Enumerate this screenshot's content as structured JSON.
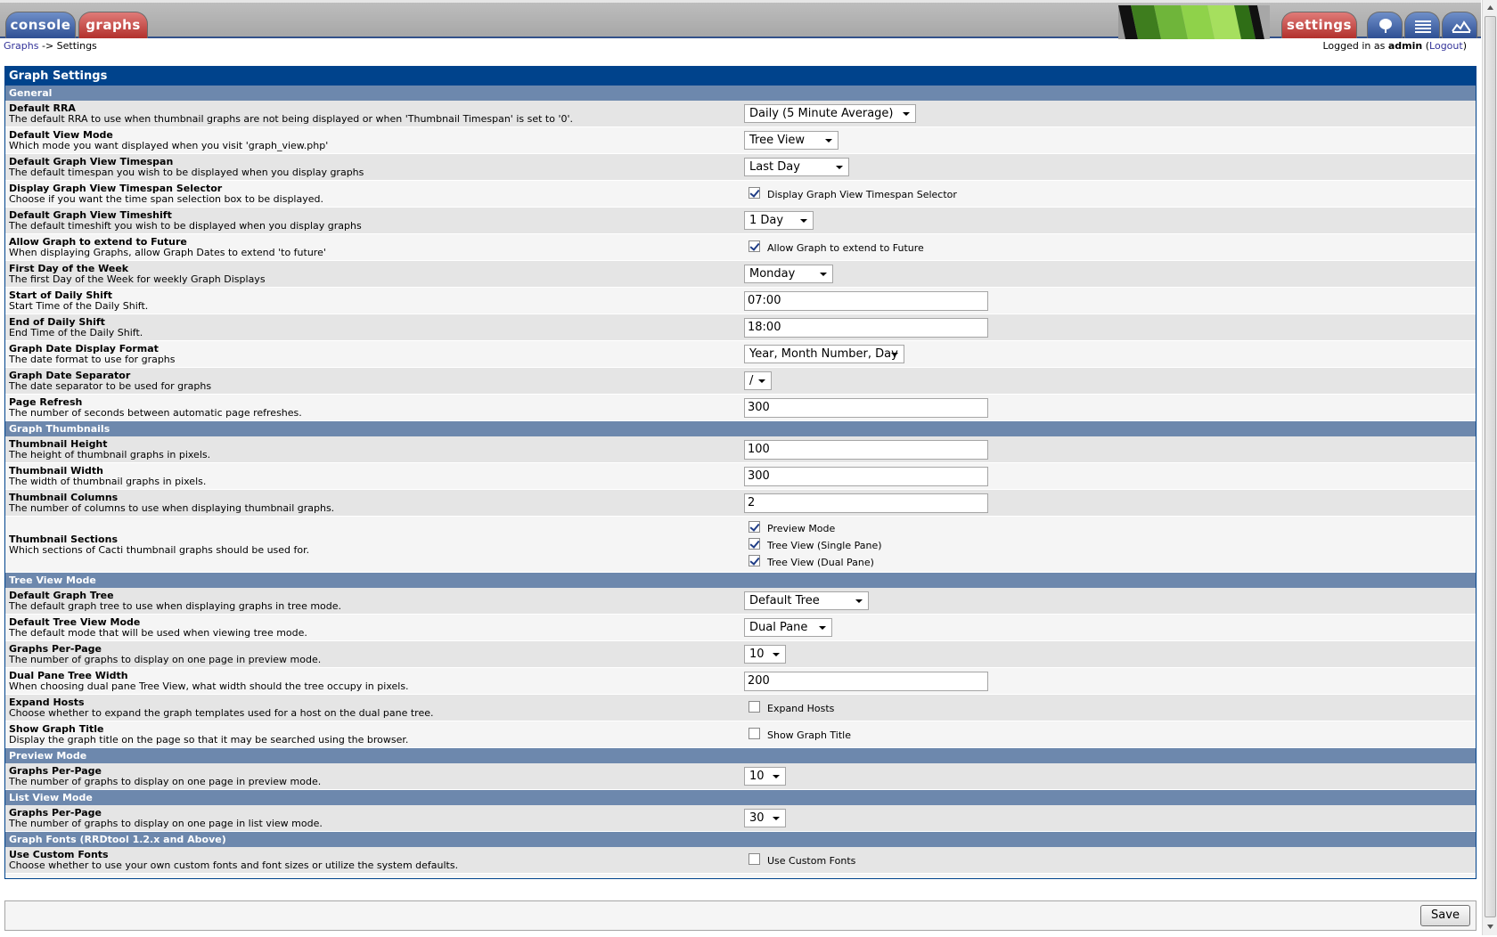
{
  "nav": {
    "console_label": "console",
    "graphs_label": "graphs",
    "settings_label": "settings",
    "icons": [
      "tree-view-icon",
      "list-view-icon",
      "preview-icon"
    ]
  },
  "breadcrumb": {
    "root": "Graphs",
    "separator": "->",
    "current": "Settings"
  },
  "login": {
    "prefix": "Logged in as",
    "user": "admin",
    "logout_label": "Logout"
  },
  "title": "Graph Settings",
  "sections": {
    "general": "General",
    "thumbnails": "Graph Thumbnails",
    "tree": "Tree View Mode",
    "preview": "Preview Mode",
    "list": "List View Mode",
    "fonts": "Graph Fonts (RRDtool 1.2.x and Above)"
  },
  "rows": {
    "default_rra": {
      "label": "Default RRA",
      "desc": "The default RRA to use when thumbnail graphs are not being displayed or when 'Thumbnail Timespan' is set to '0'.",
      "value": "Daily (5 Minute Average)"
    },
    "default_view_mode": {
      "label": "Default View Mode",
      "desc": "Which mode you want displayed when you visit 'graph_view.php'",
      "value": "Tree View"
    },
    "default_timespan": {
      "label": "Default Graph View Timespan",
      "desc": "The default timespan you wish to be displayed when you display graphs",
      "value": "Last Day"
    },
    "timespan_selector": {
      "label": "Display Graph View Timespan Selector",
      "desc": "Choose if you want the time span selection box to be displayed.",
      "check_label": "Display Graph View Timespan Selector",
      "checked": true
    },
    "default_timeshift": {
      "label": "Default Graph View Timeshift",
      "desc": "The default timeshift you wish to be displayed when you display graphs",
      "value": "1 Day"
    },
    "extend_future": {
      "label": "Allow Graph to extend to Future",
      "desc": "When displaying Graphs, allow Graph Dates to extend 'to future'",
      "check_label": "Allow Graph to extend to Future",
      "checked": true
    },
    "first_weekday": {
      "label": "First Day of the Week",
      "desc": "The first Day of the Week for weekly Graph Displays",
      "value": "Monday"
    },
    "shift_start": {
      "label": "Start of Daily Shift",
      "desc": "Start Time of the Daily Shift.",
      "value": "07:00"
    },
    "shift_end": {
      "label": "End of Daily Shift",
      "desc": "End Time of the Daily Shift.",
      "value": "18:00"
    },
    "date_format": {
      "label": "Graph Date Display Format",
      "desc": "The date format to use for graphs",
      "value": "Year, Month Number, Day"
    },
    "date_separator": {
      "label": "Graph Date Separator",
      "desc": "The date separator to be used for graphs",
      "value": "/"
    },
    "page_refresh": {
      "label": "Page Refresh",
      "desc": "The number of seconds between automatic page refreshes.",
      "value": "300"
    },
    "thumb_height": {
      "label": "Thumbnail Height",
      "desc": "The height of thumbnail graphs in pixels.",
      "value": "100"
    },
    "thumb_width": {
      "label": "Thumbnail Width",
      "desc": "The width of thumbnail graphs in pixels.",
      "value": "300"
    },
    "thumb_columns": {
      "label": "Thumbnail Columns",
      "desc": "The number of columns to use when displaying thumbnail graphs.",
      "value": "2"
    },
    "thumb_sections": {
      "label": "Thumbnail Sections",
      "desc": "Which sections of Cacti thumbnail graphs should be used for.",
      "options": [
        "Preview Mode",
        "Tree View (Single Pane)",
        "Tree View (Dual Pane)"
      ]
    },
    "default_tree": {
      "label": "Default Graph Tree",
      "desc": "The default graph tree to use when displaying graphs in tree mode.",
      "value": "Default Tree"
    },
    "tree_view_mode": {
      "label": "Default Tree View Mode",
      "desc": "The default mode that will be used when viewing tree mode.",
      "value": "Dual Pane"
    },
    "tree_per_page": {
      "label": "Graphs Per-Page",
      "desc": "The number of graphs to display on one page in preview mode.",
      "value": "10"
    },
    "tree_width": {
      "label": "Dual Pane Tree Width",
      "desc": "When choosing dual pane Tree View, what width should the tree occupy in pixels.",
      "value": "200"
    },
    "expand_hosts": {
      "label": "Expand Hosts",
      "desc": "Choose whether to expand the graph templates used for a host on the dual pane tree.",
      "check_label": "Expand Hosts",
      "checked": false
    },
    "show_title": {
      "label": "Show Graph Title",
      "desc": "Display the graph title on the page so that it may be searched using the browser.",
      "check_label": "Show Graph Title",
      "checked": false
    },
    "preview_per_page": {
      "label": "Graphs Per-Page",
      "desc": "The number of graphs to display on one page in preview mode.",
      "value": "10"
    },
    "list_per_page": {
      "label": "Graphs Per-Page",
      "desc": "The number of graphs to display on one page in list view mode.",
      "value": "30"
    },
    "custom_fonts": {
      "label": "Use Custom Fonts",
      "desc": "Choose whether to use your own custom fonts and font sizes or utilize the system defaults.",
      "check_label": "Use Custom Fonts",
      "checked": false
    }
  },
  "save_label": "Save",
  "colors": {
    "header_blue": "#00438c",
    "section_blue": "#6d88ad",
    "tab_blue": "#2e4f93",
    "tab_red": "#b2302c"
  }
}
